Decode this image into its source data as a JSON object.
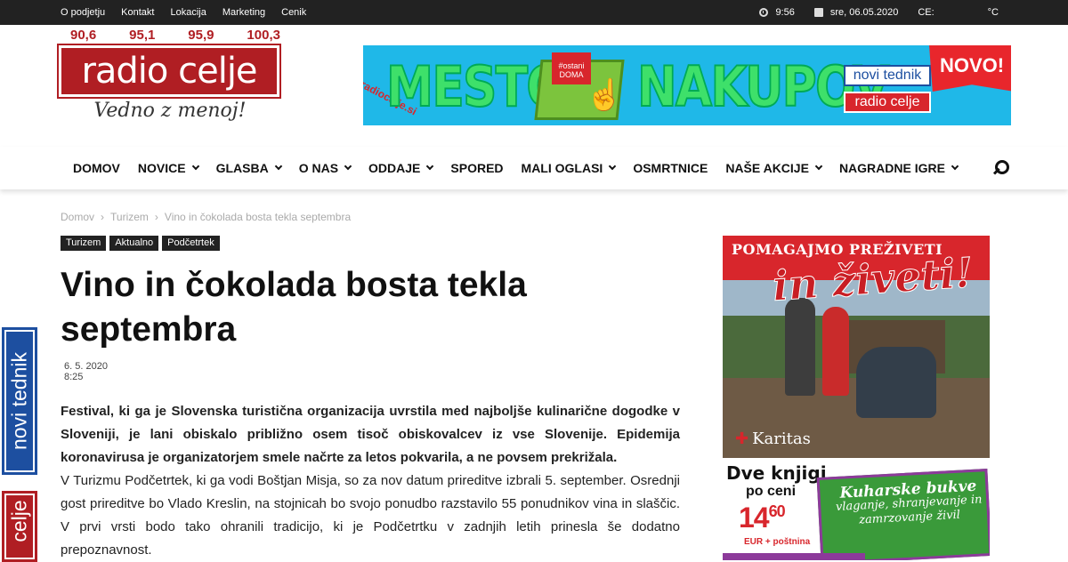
{
  "topbar": {
    "menu": [
      "O podjetju",
      "Kontakt",
      "Lokacija",
      "Marketing",
      "Cenik"
    ],
    "time": "9:56",
    "date": "sre, 06.05.2020",
    "city": "CE:",
    "temp_unit": "°C",
    "icons": [
      "clock-icon",
      "calendar-icon"
    ]
  },
  "logo": {
    "frequencies": [
      "90,6",
      "95,1",
      "95,9",
      "100,3"
    ],
    "name": "radio celje",
    "slogan": "Vedno z menoj!",
    "brand_color": "#b01e23"
  },
  "banner": {
    "word1": "MESTO",
    "word2": "NAKUPOV",
    "tag": "#ostani DOMA",
    "url": "radiocelje.si",
    "logo1": "novi tednik",
    "logo2": "radio celje",
    "badge": "NOVO!"
  },
  "nav": {
    "items": [
      {
        "label": "DOMOV",
        "dropdown": false
      },
      {
        "label": "NOVICE",
        "dropdown": true
      },
      {
        "label": "GLASBA",
        "dropdown": true
      },
      {
        "label": "O NAS",
        "dropdown": true
      },
      {
        "label": "ODDAJE",
        "dropdown": true
      },
      {
        "label": "SPORED",
        "dropdown": false
      },
      {
        "label": "MALI OGLASI",
        "dropdown": true
      },
      {
        "label": "OSMRTNICE",
        "dropdown": false
      },
      {
        "label": "NAŠE AKCIJE",
        "dropdown": true
      },
      {
        "label": "NAGRADNE IGRE",
        "dropdown": true
      }
    ],
    "search_icon": "search-icon"
  },
  "breadcrumb": [
    "Domov",
    "Turizem",
    "Vino in čokolada bosta tekla septembra"
  ],
  "categories": [
    "Turizem",
    "Aktualno",
    "Podčetrtek"
  ],
  "article": {
    "title": "Vino in čokolada bosta tekla septembra",
    "date": "6. 5. 2020",
    "time": "8:25",
    "lead": "Festival, ki ga je Slovenska turistična organizacija uvrstila med najboljše kulinarične dogodke v Sloveniji, je lani obiskalo približno osem tisoč obiskovalcev iz vse Slovenije. Epidemija koronavirusa je organizatorjem smele načrte za letos pokvarila, a ne povsem prekrižala.",
    "paragraph": "V Turizmu Podčetrtek, ki ga vodi Boštjan Misja, so za nov datum prireditve izbrali 5. september. Osrednji gost prireditve bo Vlado Kreslin, na stojnicah bo svojo ponudbo razstavilo 55 ponudnikov vina in slaščic. V prvi vrsti bodo tako ohranili tradicijo, ki je Podčetrtku v zadnjih letih prinesla še dodatno prepoznavnost."
  },
  "side_tabs": [
    "novi tednik",
    "celje"
  ],
  "ads": {
    "karitas": {
      "headline": "POMAGAJMO PREŽIVETI",
      "script": "in živeti!",
      "brand": "Karitas"
    },
    "books": {
      "line1": "Dve knjigi",
      "line2": "po ceni",
      "price_main": "14",
      "price_cents": "60",
      "price_note": "EUR + poštnina",
      "book_title": "Kuharske bukve",
      "book_sub": "vlaganje, shranjevanje in zamrzovanje živil"
    }
  }
}
